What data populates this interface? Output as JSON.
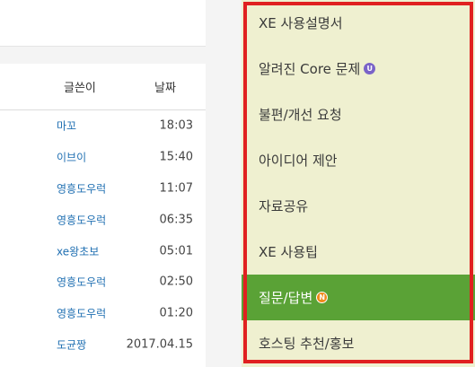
{
  "board": {
    "headers": {
      "author": "글쓴이",
      "date": "날짜"
    },
    "rows": [
      {
        "author": "마꼬",
        "date": "18:03"
      },
      {
        "author": "이브이",
        "date": "15:40"
      },
      {
        "author": "영흥도우럭",
        "date": "11:07"
      },
      {
        "author": "영흥도우럭",
        "date": "06:35"
      },
      {
        "author": "xe왕초보",
        "date": "05:01"
      },
      {
        "author": "영흥도우럭",
        "date": "02:50"
      },
      {
        "author": "영흥도우럭",
        "date": "01:20"
      },
      {
        "author": "도균짱",
        "date": "2017.04.15"
      }
    ]
  },
  "menu": {
    "items": [
      {
        "label": "XE 사용설명서",
        "badge": ""
      },
      {
        "label": "알려진 Core 문제",
        "badge": "U"
      },
      {
        "label": "불편/개선 요청",
        "badge": ""
      },
      {
        "label": "아이디어 제안",
        "badge": ""
      },
      {
        "label": "자료공유",
        "badge": ""
      },
      {
        "label": "XE 사용팁",
        "badge": ""
      },
      {
        "label": "질문/답변",
        "badge": "N"
      },
      {
        "label": "호스팅 추천/홍보",
        "badge": ""
      }
    ],
    "active_color": "#5aa236",
    "background_color": "#eff0d0",
    "highlight_frame_color": "#e02020"
  }
}
